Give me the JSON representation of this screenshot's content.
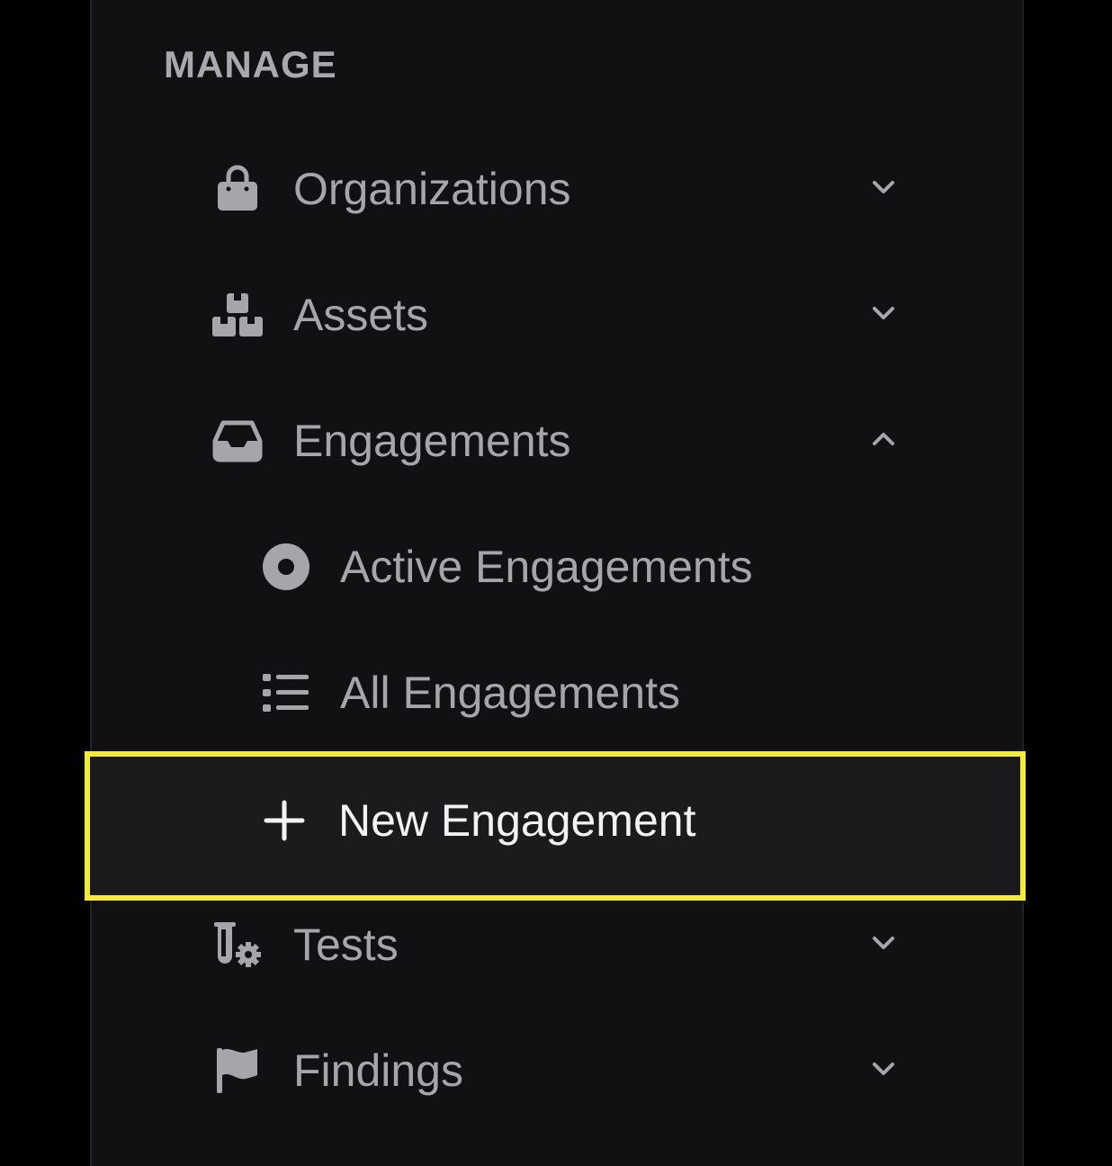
{
  "sidebar": {
    "section_title": "MANAGE",
    "items": [
      {
        "label": "Organizations",
        "icon": "shopping-bag-icon",
        "expanded": false
      },
      {
        "label": "Assets",
        "icon": "boxes-icon",
        "expanded": false
      },
      {
        "label": "Engagements",
        "icon": "inbox-icon",
        "expanded": true,
        "children": [
          {
            "label": "Active Engagements",
            "icon": "dot-circle-icon"
          },
          {
            "label": "All Engagements",
            "icon": "list-icon"
          },
          {
            "label": "New Engagement",
            "icon": "plus-icon",
            "highlighted": true
          }
        ]
      },
      {
        "label": "Tests",
        "icon": "flask-gear-icon",
        "expanded": false
      },
      {
        "label": "Findings",
        "icon": "flag-icon",
        "expanded": false
      }
    ]
  },
  "colors": {
    "background": "#000000",
    "sidebar_bg": "#111113",
    "text": "#a6a6aa",
    "highlight_border": "#f4ea3a",
    "highlight_text": "#f2f2f4"
  }
}
